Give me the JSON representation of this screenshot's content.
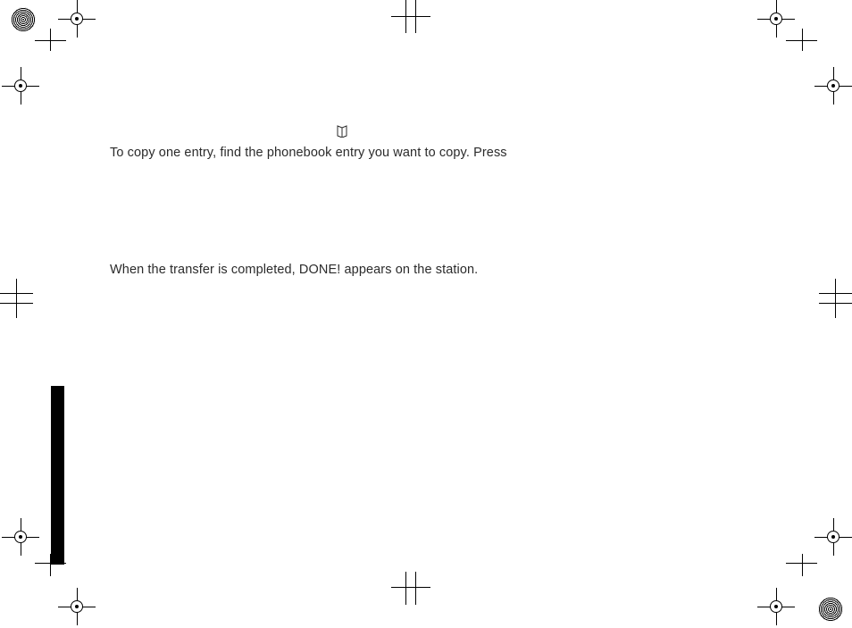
{
  "icons": {
    "phonebook": "phonebook-icon"
  },
  "body": {
    "line1": "To copy one entry, find the phonebook entry you want to copy. Press",
    "line2": "When the transfer is completed, DONE! appears on the station."
  }
}
